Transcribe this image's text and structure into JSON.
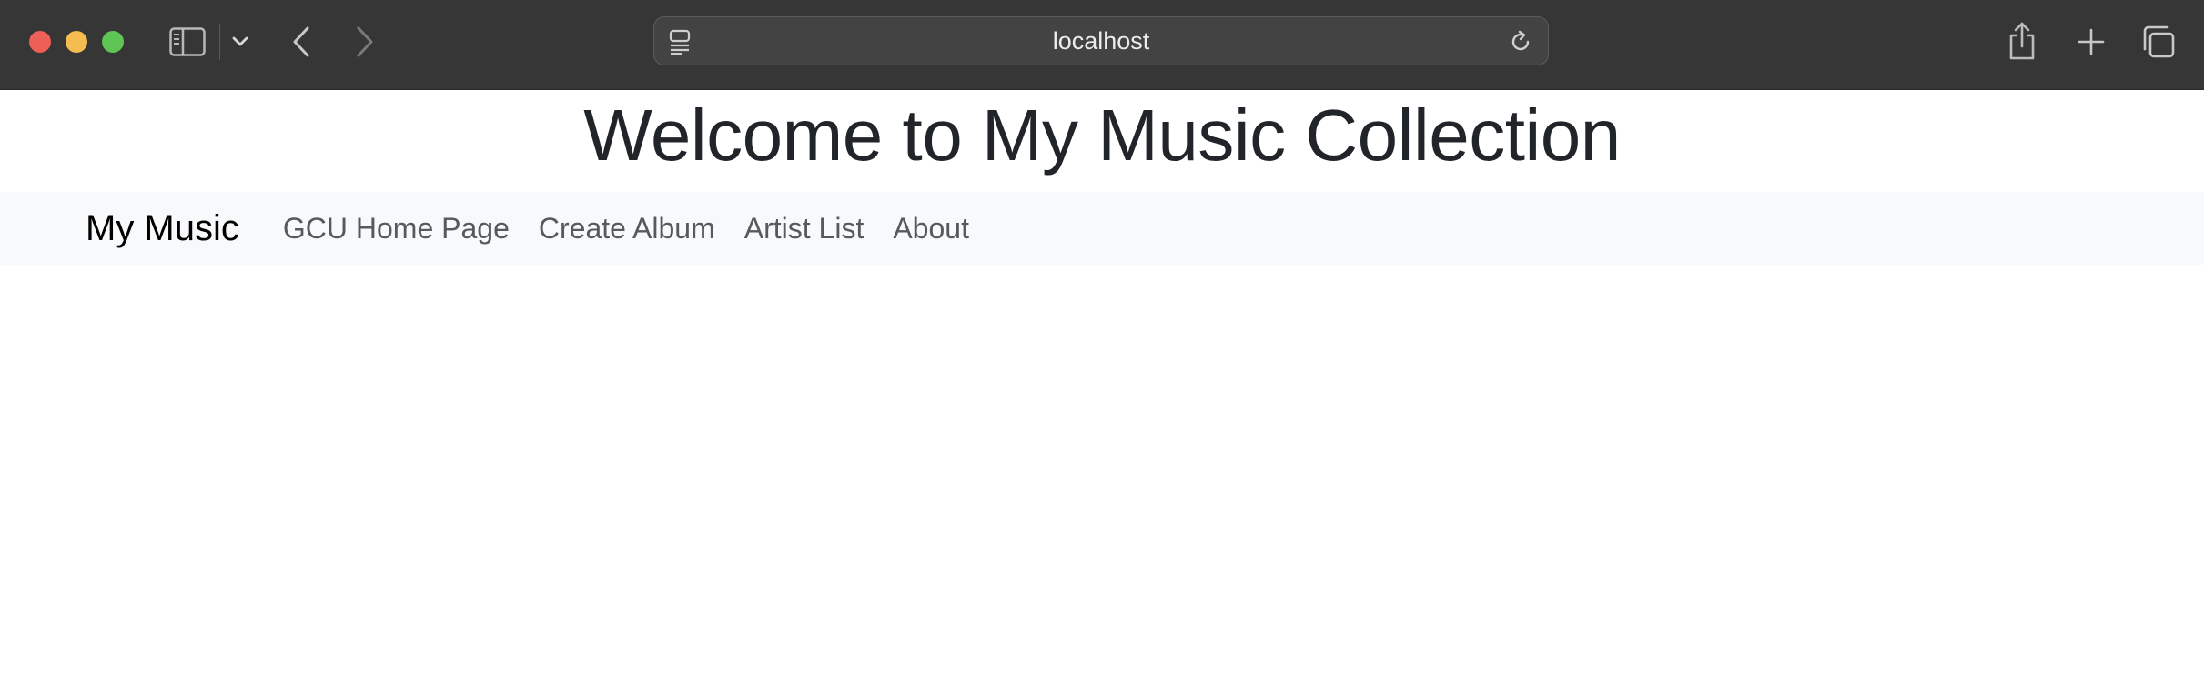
{
  "browser": {
    "address": "localhost",
    "colors": {
      "toolbar_bg": "#363636",
      "close": "#ee5f57",
      "minimize": "#f5bd4f",
      "maximize": "#5ec454"
    },
    "icons": [
      "sidebar-icon",
      "chevron-down-icon",
      "back-arrow-icon",
      "forward-arrow-icon",
      "reader-icon",
      "reload-icon",
      "share-icon",
      "plus-icon",
      "tabs-overview-icon"
    ]
  },
  "page": {
    "title": "Welcome to My Music Collection"
  },
  "navbar": {
    "brand": "My Music",
    "links": [
      {
        "label": "GCU Home Page"
      },
      {
        "label": "Create Album"
      },
      {
        "label": "Artist List"
      },
      {
        "label": "About"
      }
    ],
    "colors": {
      "bg": "#f8f9fa",
      "link": "#555a5f"
    }
  }
}
